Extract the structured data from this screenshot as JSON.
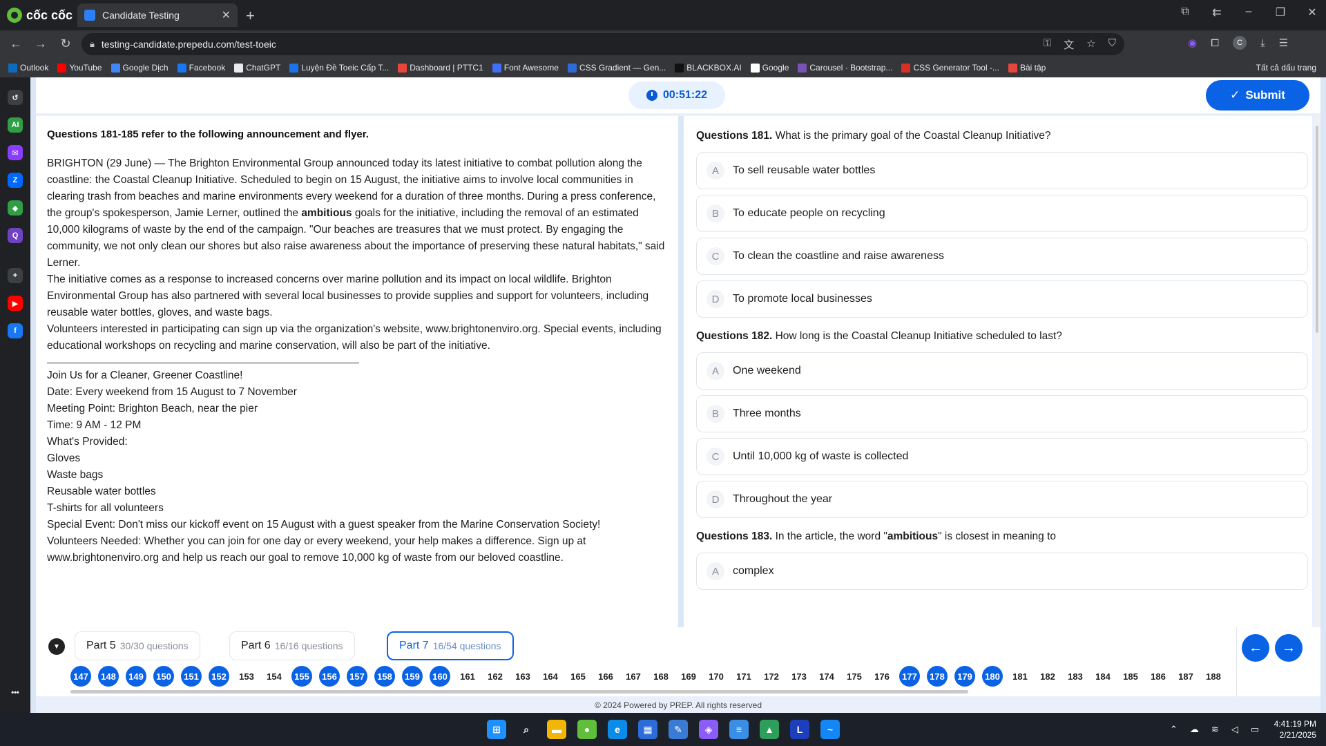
{
  "browser": {
    "brand": "cốc cốc",
    "tab_title": "Candidate Testing",
    "url": "testing-candidate.prepedu.com/test-toeic",
    "avatar_letter": "C",
    "bookmarks": [
      {
        "label": "Outlook",
        "color": "#0f6cbd"
      },
      {
        "label": "YouTube",
        "color": "#ff0000"
      },
      {
        "label": "Google Dịch",
        "color": "#4285f4"
      },
      {
        "label": "Facebook",
        "color": "#1877f2"
      },
      {
        "label": "ChatGPT",
        "color": "#e8eaed"
      },
      {
        "label": "Luyện Đề Toeic Cấp T...",
        "color": "#1a73e8"
      },
      {
        "label": "Dashboard | PTTC1",
        "color": "#e8453c"
      },
      {
        "label": "Font Awesome",
        "color": "#3f70f5"
      },
      {
        "label": "CSS Gradient — Gen...",
        "color": "#2f6bd8"
      },
      {
        "label": "BLACKBOX.AI",
        "color": "#111111"
      },
      {
        "label": "Google",
        "color": "#ffffff"
      },
      {
        "label": "Carousel · Bootstrap...",
        "color": "#7952b3"
      },
      {
        "label": "CSS Generator Tool -...",
        "color": "#d93025"
      },
      {
        "label": "Bài tập",
        "color": "#e8453c"
      }
    ],
    "all_bookmarks": "Tất cả dấu trang"
  },
  "sidebar": {
    "icons": [
      {
        "name": "history-icon",
        "label": "↺",
        "color": "#3c4043"
      },
      {
        "name": "ai-icon",
        "label": "AI",
        "color": "#2f9e44"
      },
      {
        "name": "messenger-icon",
        "label": "✉",
        "color": "#8b3dff"
      },
      {
        "name": "zalo-icon",
        "label": "Z",
        "color": "#0068ff"
      },
      {
        "name": "game-icon",
        "label": "◆",
        "color": "#2f9e44"
      },
      {
        "name": "q-icon",
        "label": "Q",
        "color": "#6f42c1"
      },
      {
        "name": "add-icon",
        "label": "+",
        "color": "#3c4043"
      },
      {
        "name": "youtube-icon",
        "label": "▶",
        "color": "#ff0000"
      },
      {
        "name": "facebook-icon",
        "label": "f",
        "color": "#1877f2"
      },
      {
        "name": "more-icon",
        "label": "•••",
        "color": "#202124"
      }
    ]
  },
  "header": {
    "timer": "00:51:22",
    "submit_label": "Submit"
  },
  "passage": {
    "title": "Questions 181-185 refer to the following announcement and flyer.",
    "p1_before": "BRIGHTON (29 June) — The Brighton Environmental Group announced today its latest initiative to combat pollution along the coastline: the Coastal Cleanup Initiative. Scheduled to begin on 15 August, the initiative aims to involve local communities in clearing trash from beaches and marine environments every weekend for a duration of three months. During a press conference, the group's spokesperson, Jamie Lerner, outlined the ",
    "p1_bold": "ambitious",
    "p1_after": " goals for the initiative, including the removal of an estimated 10,000 kilograms of waste by the end of the campaign. \"Our beaches are treasures that we must protect. By engaging the community, we not only clean our shores but also raise awareness about the importance of preserving these natural habitats,\" said Lerner.",
    "p2": "The initiative comes as a response to increased concerns over marine pollution and its impact on local wildlife. Brighton Environmental Group has also partnered with several local businesses to provide supplies and support for volunteers, including reusable water bottles, gloves, and waste bags.",
    "p3": "Volunteers interested in participating can sign up via the organization's website, www.brightonenviro.org. Special events, including educational workshops on recycling and marine conservation, will also be part of the initiative.",
    "flyer": [
      "Join Us for a Cleaner, Greener Coastline!",
      "Date: Every weekend from 15 August to 7 November",
      "Meeting Point: Brighton Beach, near the pier",
      "Time: 9 AM - 12 PM",
      "What's Provided:",
      "Gloves",
      "Waste bags",
      "Reusable water bottles",
      "T-shirts for all volunteers",
      "Special Event: Don't miss our kickoff event on 15 August with a guest speaker from the Marine Conservation Society!",
      "Volunteers Needed: Whether you can join for one day or every weekend, your help makes a difference. Sign up at www.brightonenviro.org and help us reach our goal to remove 10,000 kg of waste from our beloved coastline."
    ]
  },
  "questions": [
    {
      "label": "Questions 181.",
      "text": "What is the primary goal of the Coastal Cleanup Initiative?",
      "options": [
        {
          "letter": "A",
          "text": "To sell reusable water bottles"
        },
        {
          "letter": "B",
          "text": "To educate people on recycling"
        },
        {
          "letter": "C",
          "text": "To clean the coastline and raise awareness"
        },
        {
          "letter": "D",
          "text": "To promote local businesses"
        }
      ]
    },
    {
      "label": "Questions 182.",
      "text": "How long is the Coastal Cleanup Initiative scheduled to last?",
      "options": [
        {
          "letter": "A",
          "text": "One weekend"
        },
        {
          "letter": "B",
          "text": "Three months"
        },
        {
          "letter": "C",
          "text": "Until 10,000 kg of waste is collected"
        },
        {
          "letter": "D",
          "text": "Throughout the year"
        }
      ]
    },
    {
      "label": "Questions 183.",
      "text_before": "In the article, the word \"",
      "text_bold": "ambitious",
      "text_after": "\" is closest in meaning to",
      "options": [
        {
          "letter": "A",
          "text": "complex"
        }
      ]
    }
  ],
  "parts": [
    {
      "name": "Part 5",
      "count": "30/30 questions",
      "active": false
    },
    {
      "name": "Part 6",
      "count": "16/16 questions",
      "active": false
    },
    {
      "name": "Part 7",
      "count": "16/54 questions",
      "active": true
    }
  ],
  "question_numbers": [
    {
      "n": "147",
      "done": true
    },
    {
      "n": "148",
      "done": true
    },
    {
      "n": "149",
      "done": true
    },
    {
      "n": "150",
      "done": true
    },
    {
      "n": "151",
      "done": true
    },
    {
      "n": "152",
      "done": true
    },
    {
      "n": "153",
      "done": false
    },
    {
      "n": "154",
      "done": false
    },
    {
      "n": "155",
      "done": true
    },
    {
      "n": "156",
      "done": true
    },
    {
      "n": "157",
      "done": true
    },
    {
      "n": "158",
      "done": true
    },
    {
      "n": "159",
      "done": true
    },
    {
      "n": "160",
      "done": true
    },
    {
      "n": "161",
      "done": false
    },
    {
      "n": "162",
      "done": false
    },
    {
      "n": "163",
      "done": false
    },
    {
      "n": "164",
      "done": false
    },
    {
      "n": "165",
      "done": false
    },
    {
      "n": "166",
      "done": false
    },
    {
      "n": "167",
      "done": false
    },
    {
      "n": "168",
      "done": false
    },
    {
      "n": "169",
      "done": false
    },
    {
      "n": "170",
      "done": false
    },
    {
      "n": "171",
      "done": false
    },
    {
      "n": "172",
      "done": false
    },
    {
      "n": "173",
      "done": false
    },
    {
      "n": "174",
      "done": false
    },
    {
      "n": "175",
      "done": false
    },
    {
      "n": "176",
      "done": false
    },
    {
      "n": "177",
      "done": true
    },
    {
      "n": "178",
      "done": true
    },
    {
      "n": "179",
      "done": true
    },
    {
      "n": "180",
      "done": true
    },
    {
      "n": "181",
      "done": false
    },
    {
      "n": "182",
      "done": false
    },
    {
      "n": "183",
      "done": false
    },
    {
      "n": "184",
      "done": false
    },
    {
      "n": "185",
      "done": false
    },
    {
      "n": "186",
      "done": false
    },
    {
      "n": "187",
      "done": false
    },
    {
      "n": "188",
      "done": false
    }
  ],
  "footer": "© 2024 Powered by PREP. All rights reserved",
  "taskbar": {
    "apps": [
      {
        "name": "start-icon",
        "label": "⊞",
        "color": "#1e90ff"
      },
      {
        "name": "search-icon",
        "label": "⌕",
        "color": "#1c2028"
      },
      {
        "name": "file-explorer-icon",
        "label": "▬",
        "color": "#f2b705"
      },
      {
        "name": "coccoc-icon",
        "label": "●",
        "color": "#5fbf3a"
      },
      {
        "name": "edge-icon",
        "label": "e",
        "color": "#0c8ce9"
      },
      {
        "name": "store-icon",
        "label": "▦",
        "color": "#2b6cd9"
      },
      {
        "name": "pen-app-icon",
        "label": "✎",
        "color": "#3a7bd5"
      },
      {
        "name": "copilot-icon",
        "label": "◈",
        "color": "#8b5cf6"
      },
      {
        "name": "notepad-icon",
        "label": "≡",
        "color": "#3a8ee6"
      },
      {
        "name": "drawing-app-icon",
        "label": "▲",
        "color": "#2e9f5b"
      },
      {
        "name": "l-app-icon",
        "label": "L",
        "color": "#1d3fbb"
      },
      {
        "name": "wave-app-icon",
        "label": "~",
        "color": "#1486f5"
      }
    ],
    "time": "4:41:19 PM",
    "date": "2/21/2025"
  }
}
